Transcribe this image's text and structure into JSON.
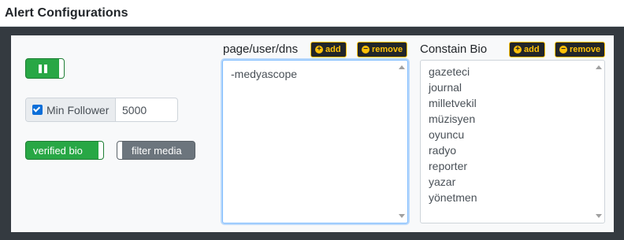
{
  "window": {
    "title": "Alert Configurations"
  },
  "controls": {
    "min_follower_label": "Min Follower",
    "min_follower_value": "5000",
    "verified_bio_label": "verified bio",
    "filter_media_label": "filter media"
  },
  "sections": {
    "pages": {
      "label": "page/user/dns",
      "add_label": "add",
      "remove_label": "remove",
      "items": [
        "-medyascope"
      ]
    },
    "bio": {
      "label": "Constain Bio",
      "add_label": "add",
      "remove_label": "remove",
      "items": [
        "gazeteci",
        "journal",
        "milletvekil",
        "müzisyen",
        "oyuncu",
        "radyo",
        "reporter",
        "yazar",
        "yönetmen"
      ]
    }
  },
  "colors": {
    "accent_green": "#28a745",
    "button_yellow": "#ffc107",
    "muted_gray": "#6c757d"
  }
}
